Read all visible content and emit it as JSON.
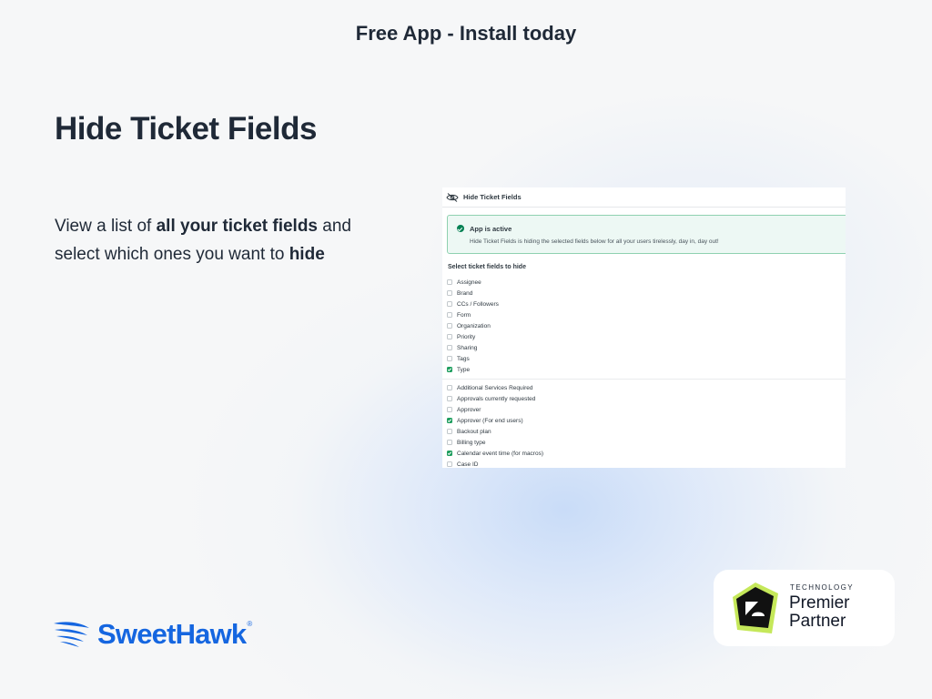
{
  "banner": "Free App - Install today",
  "title": "Hide Ticket Fields",
  "description": {
    "part1": "View a list of ",
    "bold1": "all your ticket fields",
    "part2": " and select which ones you want to ",
    "bold2": "hide"
  },
  "app": {
    "header_title": "Hide Ticket Fields",
    "header_icon": "eye-slash-icon",
    "alert_title": "App is active",
    "alert_text": "Hide Ticket Fields is hiding the selected fields below for all your users tirelessly, day in, day out!",
    "section_label": "Select ticket fields to hide",
    "system_fields": [
      {
        "label": "Assignee",
        "checked": false
      },
      {
        "label": "Brand",
        "checked": false
      },
      {
        "label": "CCs / Followers",
        "checked": false
      },
      {
        "label": "Form",
        "checked": false
      },
      {
        "label": "Organization",
        "checked": false
      },
      {
        "label": "Priority",
        "checked": false
      },
      {
        "label": "Sharing",
        "checked": false
      },
      {
        "label": "Tags",
        "checked": false
      },
      {
        "label": "Type",
        "checked": true
      }
    ],
    "custom_fields": [
      {
        "label": "Additional Services Required",
        "checked": false
      },
      {
        "label": "Approvals currently requested",
        "checked": false
      },
      {
        "label": "Approver",
        "checked": false
      },
      {
        "label": "Approver (For end users)",
        "checked": true
      },
      {
        "label": "Backout plan",
        "checked": false
      },
      {
        "label": "Billing type",
        "checked": false
      },
      {
        "label": "Calendar event time (for macros)",
        "checked": true
      },
      {
        "label": "Case ID",
        "checked": false
      }
    ]
  },
  "brand": {
    "name": "SweetHawk",
    "registered": "®",
    "color": "#1566e0"
  },
  "partner": {
    "technology": "TECHNOLOGY",
    "line1": "Premier",
    "line2": "Partner",
    "badge_icon": "zendesk-logo-icon",
    "badge_colors": [
      "#111111",
      "#c5e85a"
    ]
  }
}
